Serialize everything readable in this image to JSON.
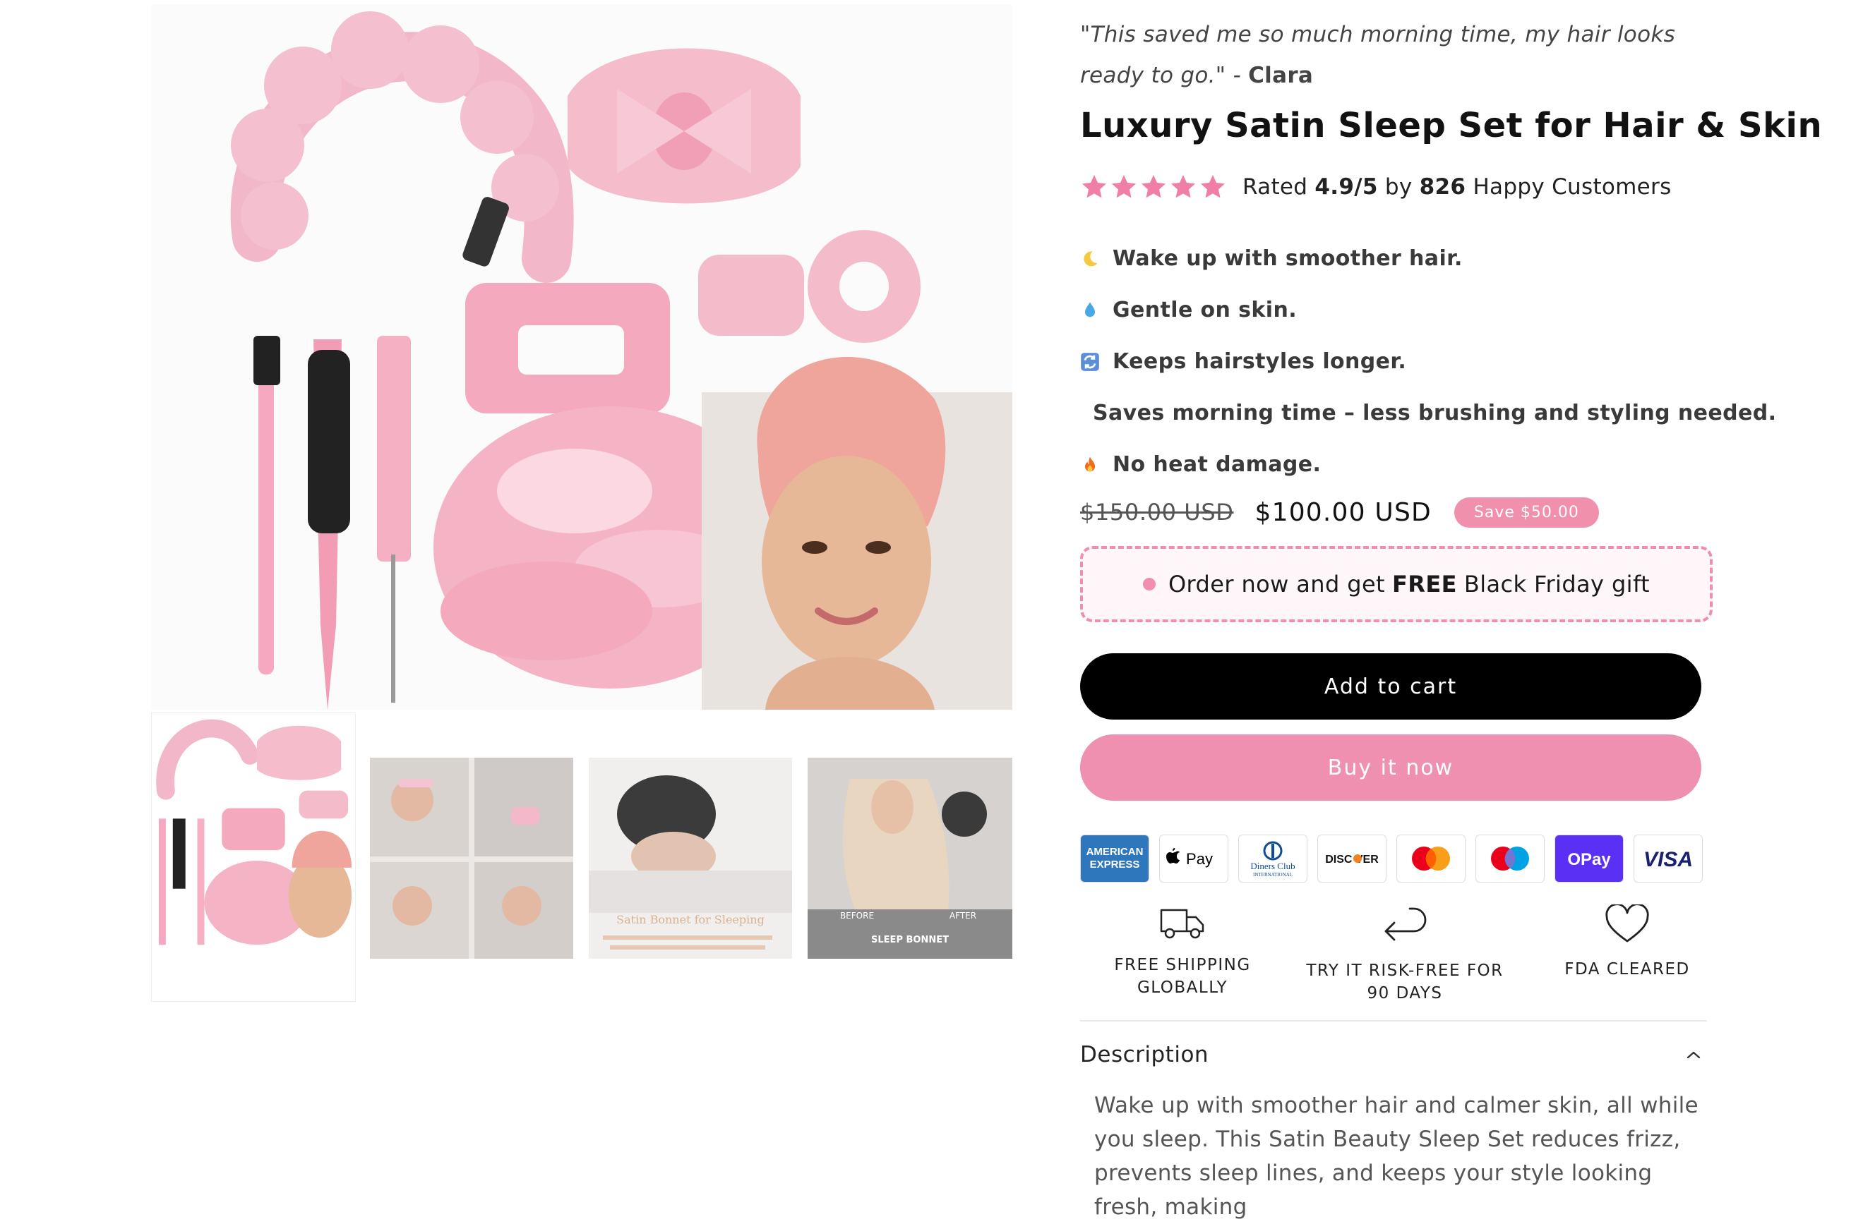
{
  "review": {
    "quote": "\"This saved me so much morning time, my hair looks ready to go.\"",
    "separator": " - ",
    "author": "Clara"
  },
  "product": {
    "title": "Luxury Satin Sleep Set for Hair & Skin",
    "rating_prefix": "Rated ",
    "rating_value": "4.9/5",
    "rating_mid": " by ",
    "rating_count": "826",
    "rating_suffix": " Happy Customers",
    "stars": 5
  },
  "benefits": [
    {
      "icon": "moon-icon",
      "text": "Wake up with smoother hair."
    },
    {
      "icon": "droplet-icon",
      "text": "Gentle on skin."
    },
    {
      "icon": "repeat-icon",
      "text": "Keeps hairstyles longer."
    },
    {
      "icon": "stopwatch-icon",
      "text": "Saves morning time – less brushing and styling needed."
    },
    {
      "icon": "fire-icon",
      "text": "No heat damage."
    }
  ],
  "price": {
    "compare_at": "$150.00 USD",
    "current": "$100.00 USD",
    "save": "Save $50.00"
  },
  "promo": {
    "prefix": "Order now and get",
    "highlight": "FREE",
    "suffix": "Black Friday gift"
  },
  "buttons": {
    "add_to_cart": "Add to cart",
    "buy_now": "Buy it now"
  },
  "payment_methods": [
    "American Express",
    "Apple Pay",
    "Diners Club",
    "Discover",
    "Mastercard",
    "Maestro",
    "OPay",
    "Visa"
  ],
  "trust_badges": [
    {
      "icon": "truck-icon",
      "line1": "FREE SHIPPING",
      "line2": "GLOBALLY"
    },
    {
      "icon": "return-arrow-icon",
      "line1": "TRY IT RISK-FREE FOR",
      "line2": "90 DAYS"
    },
    {
      "icon": "heart-icon",
      "line1": "FDA CLEARED",
      "line2": ""
    }
  ],
  "description": {
    "heading": "Description",
    "text": "Wake up with smoother hair and calmer skin, all while you sleep. This Satin Beauty Sleep Set reduces frizz, prevents sleep lines, and keeps your style looking fresh, making"
  },
  "thumbnails": {
    "thumb3_caption": "Satin Bonnet for Sleeping",
    "thumb4_before": "BEFORE",
    "thumb4_after": "AFTER",
    "thumb4_caption": "SLEEP BONNET"
  },
  "colors": {
    "accent_pink": "#f090b0",
    "cart_button": "#000000",
    "star": "#ef7fa6"
  }
}
